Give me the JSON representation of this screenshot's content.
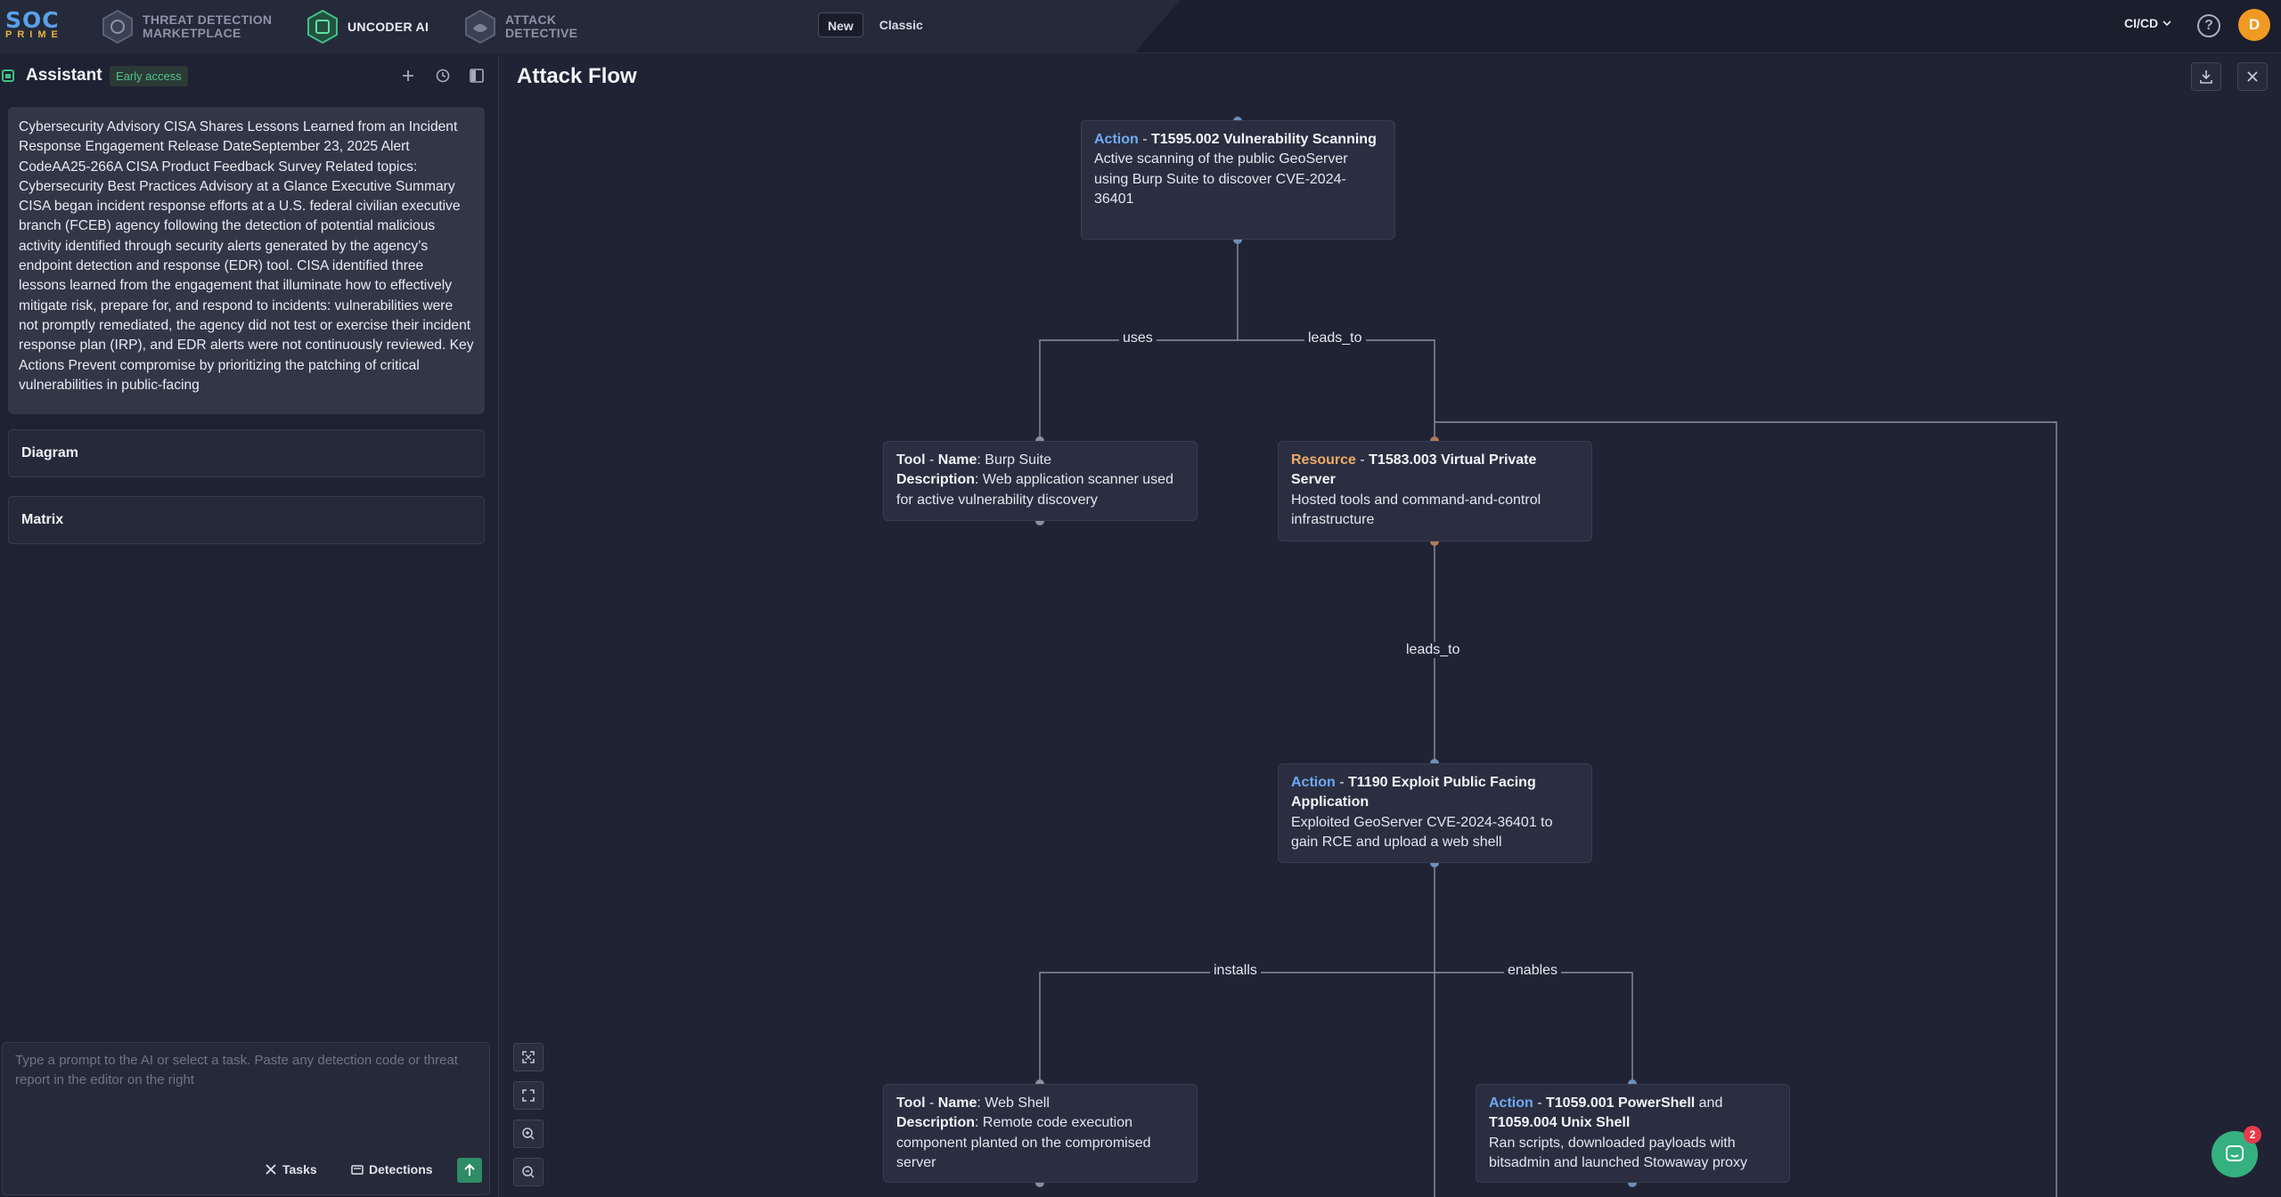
{
  "topbar": {
    "logo_line1": "SOC",
    "logo_line2": "PRIME",
    "nav": [
      {
        "line1": "THREAT DETECTION",
        "line2": "MARKETPLACE"
      },
      {
        "line1": "UNCODER AI",
        "line2": ""
      },
      {
        "line1": "ATTACK",
        "line2": "DETECTIVE"
      }
    ],
    "mode_new": "New",
    "mode_classic": "Classic",
    "env_select": "CI/CD",
    "help": "?",
    "avatar_initial": "D"
  },
  "assistant": {
    "title": "Assistant",
    "badge": "Early access",
    "report_text": "Cybersecurity Advisory CISA Shares Lessons Learned from an Incident Response Engagement Release DateSeptember 23, 2025 Alert CodeAA25-266A CISA Product Feedback Survey Related topics: Cybersecurity Best Practices Advisory at a Glance Executive Summary CISA began incident response efforts at a U.S. federal civilian executive branch (FCEB) agency following the detection of potential malicious activity identified through security alerts generated by the agency’s endpoint detection and response (EDR) tool. CISA identified three lessons learned from the engagement that illuminate how to effectively mitigate risk, prepare for, and respond to incidents: vulnerabilities were not promptly remediated, the agency did not test or exercise their incident response plan (IRP), and EDR alerts were not continuously reviewed. Key Actions Prevent compromise by prioritizing the patching of critical vulnerabilities in public-facing",
    "sections": [
      "Diagram",
      "Matrix"
    ],
    "prompt_placeholder": "Type a prompt to the AI or select a task. Paste any detection code or threat report in the editor on the right",
    "tasks_label": "Tasks",
    "detections_label": "Detections"
  },
  "canvas": {
    "title": "Attack Flow",
    "nodes": {
      "n1": {
        "kind": "Action",
        "sep": " - ",
        "name": "T1595.002 Vulnerability Scanning",
        "desc": "Active scanning of the public GeoServer using Burp Suite to discover CVE-2024-36401"
      },
      "n2": {
        "kind": "Tool",
        "sep": " - ",
        "name_label": "Name",
        "name": "Burp Suite",
        "desc_label": "Description",
        "desc": "Web application scanner used for active vulnerability discovery"
      },
      "n3": {
        "kind": "Resource",
        "sep": " - ",
        "name": "T1583.003 Virtual Private Server",
        "desc": "Hosted tools and command-and-control infrastructure"
      },
      "n4": {
        "kind": "Action",
        "sep": " - ",
        "name": "T1190 Exploit Public Facing Application",
        "desc": "Exploited GeoServer CVE-2024-36401 to gain RCE and upload a web shell"
      },
      "n5": {
        "kind": "Tool",
        "sep": " - ",
        "name_label": "Name",
        "name": "Web Shell",
        "desc_label": "Description",
        "desc": "Remote code execution component planted on the compromised server"
      },
      "n6": {
        "kind": "Action",
        "sep": " - ",
        "name_a": "T1059.001 PowerShell",
        "and": " and ",
        "name_b": "T1059.004 Unix Shell",
        "desc": "Ran scripts, downloaded payloads with bitsadmin and launched Stowaway proxy"
      }
    },
    "edges": [
      "uses",
      "leads_to",
      "leads_to",
      "installs",
      "enables"
    ]
  },
  "chat_widget": {
    "count": "2"
  },
  "colors": {
    "action": "#6fa9f5",
    "resource": "#efaa68",
    "accent": "#34b17f",
    "avatar": "#f09a23"
  }
}
